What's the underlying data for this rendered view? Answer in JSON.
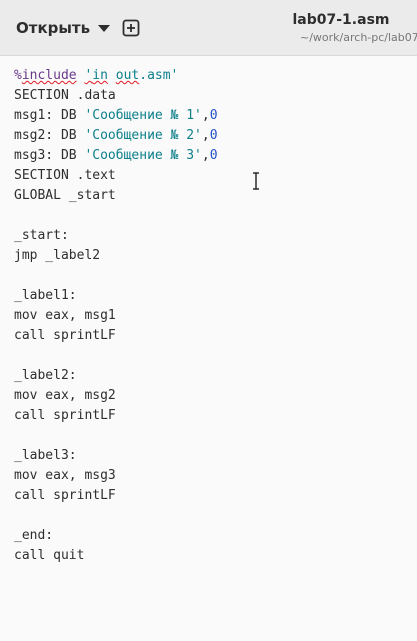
{
  "header": {
    "open_label": "Открыть",
    "title": "lab07-1.asm",
    "path": "~/work/arch-pc/lab07"
  },
  "code": {
    "l1_pct": "%",
    "l1_include": "include",
    "l1_str_a": "'",
    "l1_in": "in",
    "l1_space": " ",
    "l1_out": "out",
    "l1_str_b": ".asm'",
    "l2": "SECTION .data",
    "l3_a": "msg1: DB ",
    "l3_s": "'Сообщение № 1'",
    "l3_c": ",",
    "l3_n": "0",
    "l4_a": "msg2: DB ",
    "l4_s": "'Сообщение № 2'",
    "l4_c": ",",
    "l4_n": "0",
    "l5_a": "msg3: DB ",
    "l5_s": "'Сообщение № 3'",
    "l5_c": ",",
    "l5_n": "0",
    "l6": "SECTION .text",
    "l7": "GLOBAL _start",
    "l9": "_start:",
    "l10": "jmp _label2",
    "l12": "_label1:",
    "l13": "mov eax, msg1",
    "l14": "call sprintLF",
    "l16": "_label2:",
    "l17": "mov eax, msg2",
    "l18": "call sprintLF",
    "l20": "_label3:",
    "l21": "mov eax, msg3",
    "l22": "call sprintLF",
    "l24": "_end:",
    "l25": "call quit"
  },
  "icons": {
    "open_menu": "chevron-down-icon",
    "new_tab": "new-tab-icon",
    "cursor": "text-cursor-icon"
  }
}
